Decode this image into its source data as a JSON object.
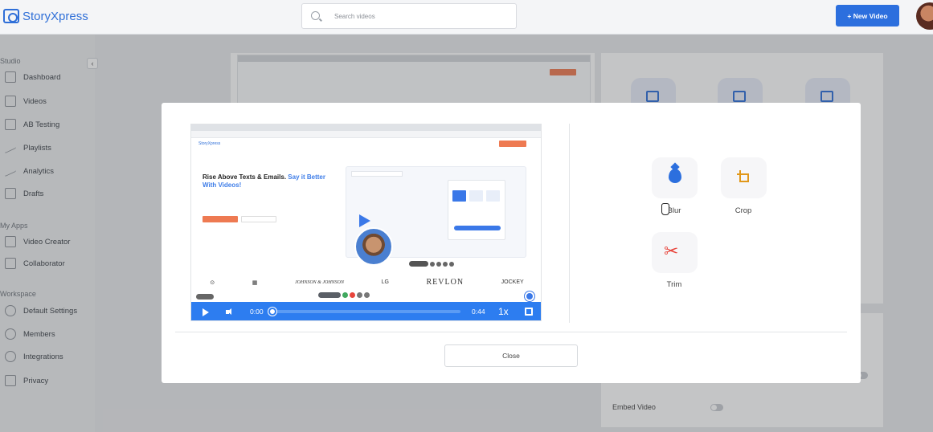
{
  "app": {
    "logo_text": "StoryXpress"
  },
  "header": {
    "search_placeholder": "Search videos",
    "new_video_label": "+ New Video"
  },
  "sidebar": {
    "sections": [
      {
        "title": "Studio",
        "items": [
          {
            "label": "Dashboard",
            "icon": "dashboard-icon"
          },
          {
            "label": "Videos",
            "icon": "play-icon"
          },
          {
            "label": "AB Testing",
            "icon": "ab-test-icon"
          },
          {
            "label": "Playlists",
            "icon": "playlist-icon"
          },
          {
            "label": "Analytics",
            "icon": "analytics-icon"
          },
          {
            "label": "Drafts",
            "icon": "drafts-icon"
          }
        ]
      },
      {
        "title": "My Apps",
        "items": [
          {
            "label": "Video Creator",
            "icon": "video-creator-icon"
          },
          {
            "label": "Collaborator",
            "icon": "collaborator-icon"
          }
        ]
      },
      {
        "title": "Workspace",
        "items": [
          {
            "label": "Default Settings",
            "icon": "settings-icon"
          },
          {
            "label": "Members",
            "icon": "members-icon"
          },
          {
            "label": "Integrations",
            "icon": "integrations-icon"
          },
          {
            "label": "Privacy",
            "icon": "privacy-icon"
          }
        ]
      }
    ]
  },
  "background": {
    "embed_video_label": "Embed Video"
  },
  "modal": {
    "video": {
      "headline_part1": "Rise Above Texts & Emails.",
      "headline_part2": "Say it Better With Videos!",
      "brands": [
        "JOHNSON & JOHNSON",
        "LG",
        "REVLON",
        "JOCKEY"
      ],
      "current_time": "0:00",
      "duration": "0:44",
      "speed": "1x",
      "progress": 0
    },
    "tools": [
      {
        "label": "Blur",
        "icon": "blur-drop-icon",
        "color": "#2c6fde"
      },
      {
        "label": "Crop",
        "icon": "crop-icon",
        "color": "#e1981a"
      },
      {
        "label": "Trim",
        "icon": "scissors-icon",
        "color": "#e8453c"
      }
    ],
    "close_label": "Close"
  }
}
